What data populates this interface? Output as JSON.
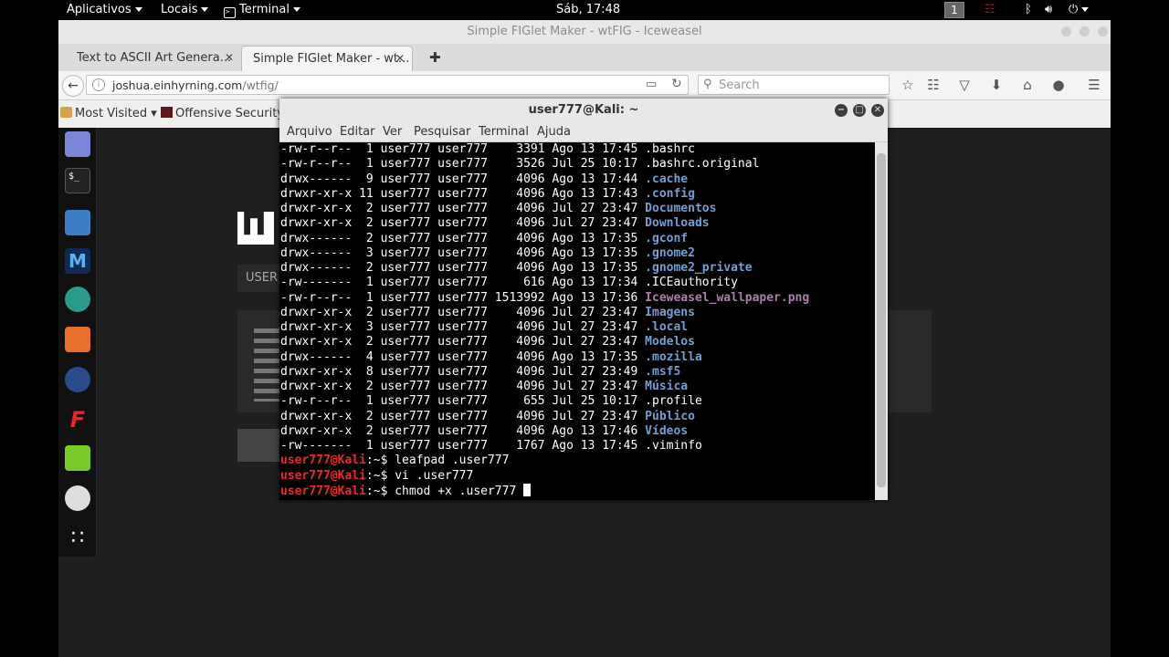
{
  "topbar": {
    "apps": "Aplicativos",
    "places": "Locais",
    "terminal": "Terminal",
    "clock": "Sáb, 17:48",
    "workspace": "1"
  },
  "browser": {
    "window_title": "Simple FIGlet Maker - wtFIG - Iceweasel",
    "tabs": [
      {
        "label": "Text to ASCII Art Genera..."
      },
      {
        "label": "Simple FIGlet Maker - wt..."
      }
    ],
    "url_host": "joshua.einhyrning.com",
    "url_path": "/wtfig/",
    "search_placeholder": "Search",
    "bookmarks": [
      {
        "label": "Most Visited ▾"
      },
      {
        "label": "Offensive Security"
      }
    ]
  },
  "terminal": {
    "title": "user777@Kali: ~",
    "menu": [
      "Arquivo",
      "Editar",
      "Ver",
      "Pesquisar",
      "Terminal",
      "Ajuda"
    ],
    "listing": [
      {
        "meta": "-rw-r--r--  1 user777 user777    3391 Ago 13 17:45 ",
        "name": ".bashrc",
        "kind": "file"
      },
      {
        "meta": "-rw-r--r--  1 user777 user777    3526 Jul 25 10:17 ",
        "name": ".bashrc.original",
        "kind": "file"
      },
      {
        "meta": "drwx------  9 user777 user777    4096 Ago 13 17:44 ",
        "name": ".cache",
        "kind": "dir"
      },
      {
        "meta": "drwxr-xr-x 11 user777 user777    4096 Ago 13 17:43 ",
        "name": ".config",
        "kind": "dir"
      },
      {
        "meta": "drwxr-xr-x  2 user777 user777    4096 Jul 27 23:47 ",
        "name": "Documentos",
        "kind": "dir"
      },
      {
        "meta": "drwxr-xr-x  2 user777 user777    4096 Jul 27 23:47 ",
        "name": "Downloads",
        "kind": "dir"
      },
      {
        "meta": "drwx------  2 user777 user777    4096 Ago 13 17:35 ",
        "name": ".gconf",
        "kind": "dir"
      },
      {
        "meta": "drwx------  3 user777 user777    4096 Ago 13 17:35 ",
        "name": ".gnome2",
        "kind": "dir"
      },
      {
        "meta": "drwx------  2 user777 user777    4096 Ago 13 17:35 ",
        "name": ".gnome2_private",
        "kind": "dir"
      },
      {
        "meta": "-rw-------  1 user777 user777     616 Ago 13 17:34 ",
        "name": ".ICEauthority",
        "kind": "file"
      },
      {
        "meta": "-rw-r--r--  1 user777 user777 1513992 Ago 13 17:36 ",
        "name": "Iceweasel_wallpaper.png",
        "kind": "img"
      },
      {
        "meta": "drwxr-xr-x  2 user777 user777    4096 Jul 27 23:47 ",
        "name": "Imagens",
        "kind": "dir"
      },
      {
        "meta": "drwxr-xr-x  3 user777 user777    4096 Jul 27 23:47 ",
        "name": ".local",
        "kind": "dir"
      },
      {
        "meta": "drwxr-xr-x  2 user777 user777    4096 Jul 27 23:47 ",
        "name": "Modelos",
        "kind": "dir"
      },
      {
        "meta": "drwx------  4 user777 user777    4096 Ago 13 17:35 ",
        "name": ".mozilla",
        "kind": "dir"
      },
      {
        "meta": "drwxr-xr-x  8 user777 user777    4096 Jul 27 23:49 ",
        "name": ".msf5",
        "kind": "dir"
      },
      {
        "meta": "drwxr-xr-x  2 user777 user777    4096 Jul 27 23:47 ",
        "name": "Música",
        "kind": "dir"
      },
      {
        "meta": "-rw-r--r--  1 user777 user777     655 Jul 25 10:17 ",
        "name": ".profile",
        "kind": "file"
      },
      {
        "meta": "drwxr-xr-x  2 user777 user777    4096 Jul 27 23:47 ",
        "name": "Público",
        "kind": "dir"
      },
      {
        "meta": "drwxr-xr-x  2 user777 user777    4096 Ago 13 17:46 ",
        "name": "Vídeos",
        "kind": "dir"
      },
      {
        "meta": "-rw-------  1 user777 user777    1767 Ago 13 17:45 ",
        "name": ".viminfo",
        "kind": "file"
      }
    ],
    "prompt_user": "user777@Kali",
    "prompt_suffix": ":~$ ",
    "commands": [
      "leafpad .user777",
      "vi .user777",
      "chmod +x .user777 "
    ]
  },
  "page_fragment": {
    "label": "USER"
  },
  "colors": {
    "dir": "#729fcf",
    "img": "#ad7fa8",
    "prompt": "#ef2929",
    "terminal_bg": "#000000"
  },
  "dock": {
    "icons": [
      "pidgin-icon",
      "terminal-icon",
      "files-icon",
      "metasploit-icon",
      "armitage-icon",
      "burpsuite-icon",
      "maltego-icon",
      "faraday-icon",
      "leafpad-icon",
      "screenshot-icon",
      "show-apps-icon"
    ]
  }
}
